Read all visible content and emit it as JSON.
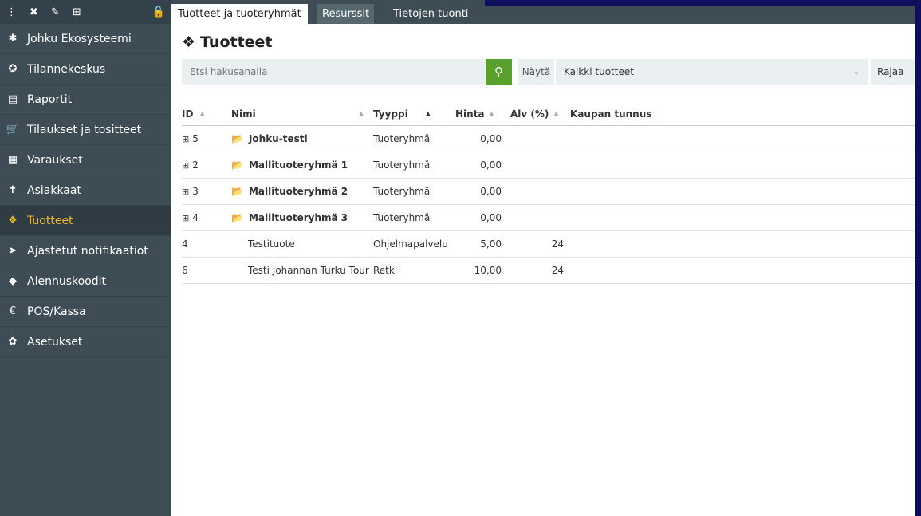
{
  "sidebar": {
    "items": [
      {
        "icon": "gear-icon",
        "glyph": "✱",
        "label": "Johku Ekosysteemi"
      },
      {
        "icon": "dashboard-icon",
        "glyph": "✪",
        "label": "Tilannekeskus"
      },
      {
        "icon": "report-icon",
        "glyph": "▤",
        "label": "Raportit"
      },
      {
        "icon": "cart-icon",
        "glyph": "🛒",
        "label": "Tilaukset ja tositteet"
      },
      {
        "icon": "calendar-icon",
        "glyph": "▦",
        "label": "Varaukset"
      },
      {
        "icon": "person-icon",
        "glyph": "✝",
        "label": "Asiakkaat"
      },
      {
        "icon": "cubes-icon",
        "glyph": "❖",
        "label": "Tuotteet"
      },
      {
        "icon": "paper-plane-icon",
        "glyph": "➤",
        "label": "Ajastetut notifikaatiot"
      },
      {
        "icon": "tag-icon",
        "glyph": "◆",
        "label": "Alennuskoodit"
      },
      {
        "icon": "euro-icon",
        "glyph": "€",
        "label": "POS/Kassa"
      },
      {
        "icon": "cog-icon",
        "glyph": "✿",
        "label": "Asetukset"
      }
    ],
    "active_index": 6
  },
  "tabs": [
    "Tuotteet ja tuoteryhmät",
    "Resurssit",
    "Tietojen tuonti"
  ],
  "page_title": "Tuotteet",
  "search": {
    "placeholder": "Etsi hakusanalla"
  },
  "filter": {
    "label": "Näytä",
    "selected": "Kaikki tuotteet",
    "rajaa": "Rajaa"
  },
  "table": {
    "headers": {
      "id": "ID",
      "nimi": "Nimi",
      "tyyppi": "Tyyppi",
      "hinta": "Hinta",
      "alv": "Alv (%)",
      "kauppa": "Kaupan tunnus"
    },
    "rows": [
      {
        "id": "5",
        "name": "Johku-testi",
        "type": "Tuoteryhmä",
        "price": "0,00",
        "vat": "",
        "group": true
      },
      {
        "id": "2",
        "name": "Mallituoteryhmä 1",
        "type": "Tuoteryhmä",
        "price": "0,00",
        "vat": "",
        "group": true
      },
      {
        "id": "3",
        "name": "Mallituoteryhmä 2",
        "type": "Tuoteryhmä",
        "price": "0,00",
        "vat": "",
        "group": true
      },
      {
        "id": "4",
        "name": "Mallituoteryhmä 3",
        "type": "Tuoteryhmä",
        "price": "0,00",
        "vat": "",
        "group": true
      },
      {
        "id": "4",
        "name": "Testituote",
        "type": "Ohjelmapalvelu",
        "price": "5,00",
        "vat": "24",
        "group": false
      },
      {
        "id": "6",
        "name": "Testi Johannan Turku Tour",
        "type": "Retki",
        "price": "10,00",
        "vat": "24",
        "group": false
      }
    ]
  }
}
